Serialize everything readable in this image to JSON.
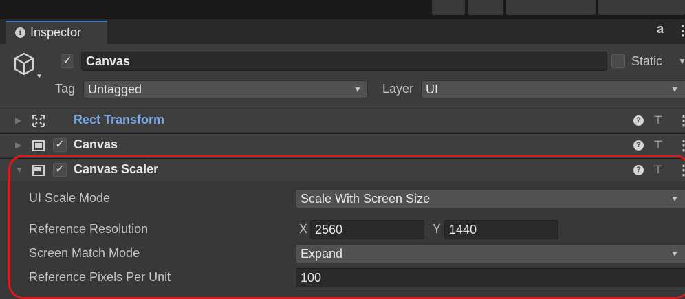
{
  "tab": {
    "label": "Inspector"
  },
  "gameobject": {
    "name": "Canvas",
    "active": true,
    "static_label": "Static",
    "tag_label": "Tag",
    "tag_value": "Untagged",
    "layer_label": "Layer",
    "layer_value": "UI"
  },
  "components": [
    {
      "title": "Rect Transform",
      "title_color": "#7aa8e6",
      "has_checkbox": false,
      "expanded": false
    },
    {
      "title": "Canvas",
      "title_color": "#e6e6e6",
      "has_checkbox": true,
      "expanded": false
    },
    {
      "title": "Canvas Scaler",
      "title_color": "#e6e6e6",
      "has_checkbox": true,
      "expanded": true
    }
  ],
  "canvas_scaler": {
    "ui_scale_mode_label": "UI Scale Mode",
    "ui_scale_mode_value": "Scale With Screen Size",
    "ref_res_label": "Reference Resolution",
    "ref_res_x_label": "X",
    "ref_res_x": "2560",
    "ref_res_y_label": "Y",
    "ref_res_y": "1440",
    "match_mode_label": "Screen Match Mode",
    "match_mode_value": "Expand",
    "ppu_label": "Reference Pixels Per Unit",
    "ppu_value": "100"
  },
  "colors": {
    "highlight": "#e01818",
    "tab_accent": "#3a79bb"
  }
}
